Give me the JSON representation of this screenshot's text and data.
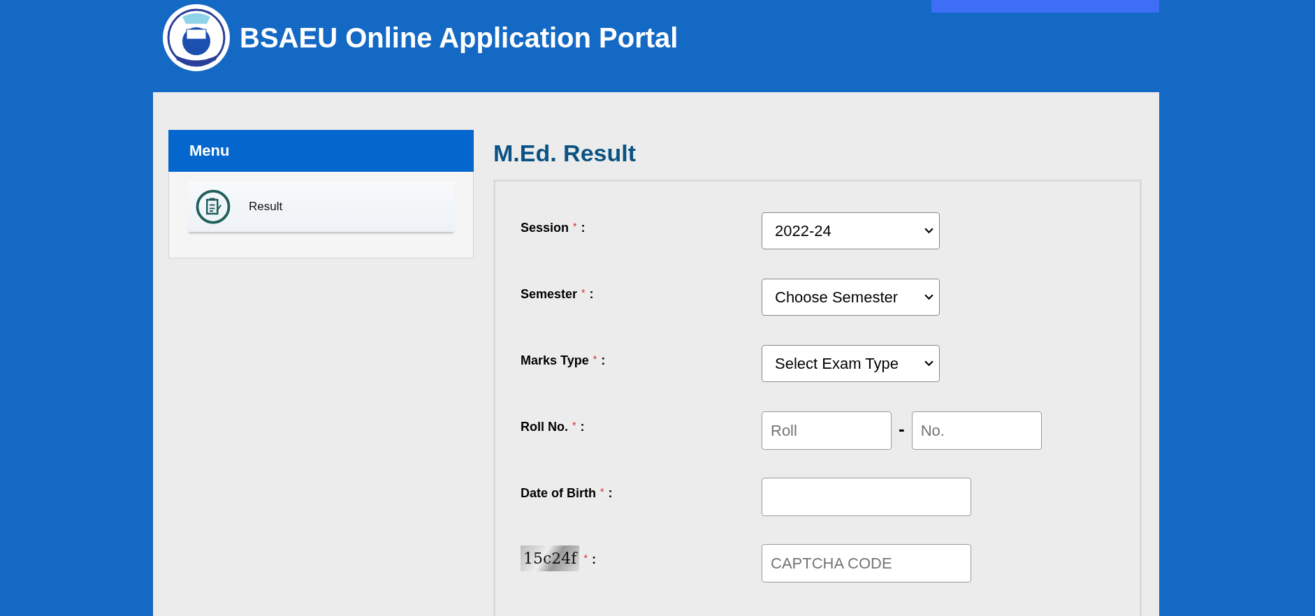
{
  "header": {
    "title": "BSAEU Online Application Portal"
  },
  "sidebar": {
    "title": "Menu",
    "items": [
      {
        "label": "Result"
      }
    ]
  },
  "page_title": "M.Ed. Result",
  "form": {
    "fields": [
      {
        "kind": "select",
        "label": "Session",
        "required_mark": "*",
        "colon": ":",
        "value": "2022-24"
      },
      {
        "kind": "select",
        "label": "Semester",
        "required_mark": "*",
        "colon": ":",
        "value": "Choose Semester"
      },
      {
        "kind": "select",
        "label": "Marks Type",
        "required_mark": "*",
        "colon": ":",
        "value": "Select Exam Type"
      },
      {
        "kind": "split",
        "label": "Roll No.",
        "required_mark": "*",
        "colon": ":",
        "separator": "-",
        "parts": [
          {
            "placeholder": "Roll"
          },
          {
            "placeholder": "No."
          }
        ]
      },
      {
        "kind": "text",
        "label": "Date of Birth",
        "required_mark": "*",
        "colon": ":"
      },
      {
        "kind": "captcha",
        "captcha": "15c24f",
        "required_mark": "*",
        "colon": ":",
        "placeholder": "CAPTCHA CODE"
      }
    ]
  }
}
